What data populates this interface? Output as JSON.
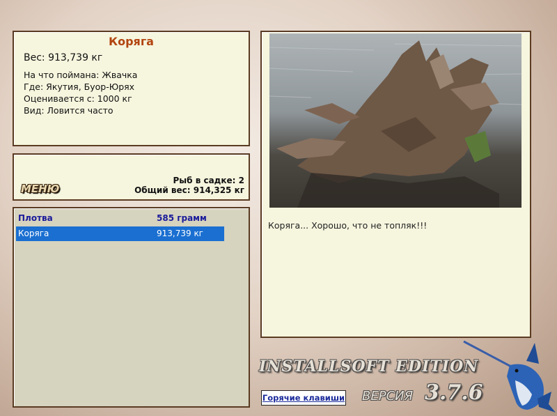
{
  "catch": {
    "name": "Коряга",
    "weight": "Вес: 913,739 кг",
    "details": [
      "На что поймана: Жвачка",
      "Где: Якутия, Буор-Юрях",
      "Оценивается с: 1000 кг",
      "Вид: Ловится часто"
    ]
  },
  "status": {
    "menu_label": "МЕНЮ",
    "fish_count": "Рыб в садке: 2",
    "total_weight": "Общий вес: 914,325 кг"
  },
  "catch_list": {
    "rows": [
      {
        "name": "Плотва",
        "weight": "585 грамм"
      },
      {
        "name": "Коряга",
        "weight": "913,739 кг"
      }
    ]
  },
  "photo": {
    "caption": "Коряга... Хорошо, что не топляк!!!"
  },
  "footer": {
    "edition": "INSTALLSOFT EDITION",
    "version_label": "ВЕРСИЯ",
    "version_number": "3.7.6",
    "hotkeys_label": "Горячие клавиши"
  },
  "colors": {
    "title": "#b2440f",
    "selection": "#1a6fd1",
    "panel_bg": "#f6f5de",
    "panel_border": "#5a3b22"
  }
}
